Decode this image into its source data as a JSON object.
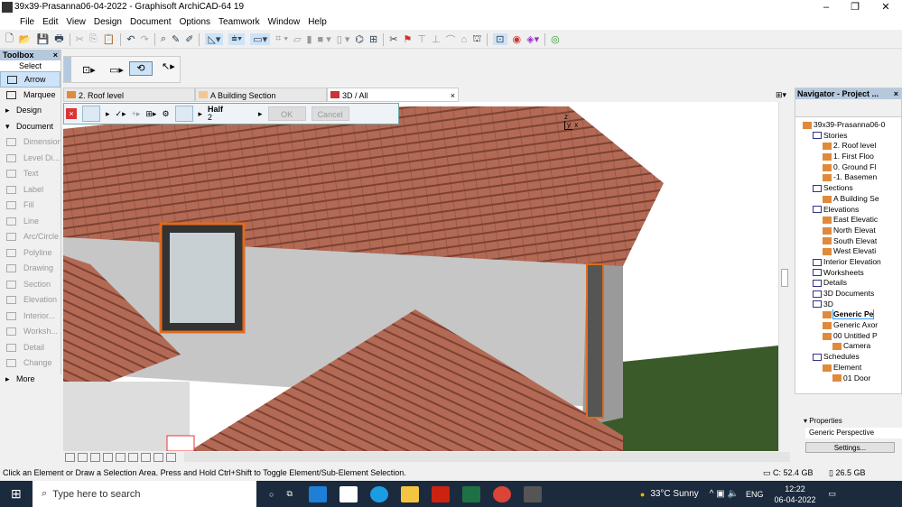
{
  "window": {
    "title": "39x39-Prasanna06-04-2022 - Graphisoft ArchiCAD-64 19",
    "minimize": "–",
    "maximize": "❐",
    "close": "✕"
  },
  "menu": [
    "File",
    "Edit",
    "View",
    "Design",
    "Document",
    "Options",
    "Teamwork",
    "Window",
    "Help"
  ],
  "toolbox": {
    "title": "Toolbox",
    "close": "×",
    "select": "Select",
    "items": [
      {
        "label": "Arrow",
        "state": "selected"
      },
      {
        "label": "Marquee",
        "state": "dark"
      },
      {
        "label": "Design",
        "state": "group"
      },
      {
        "label": "Document",
        "state": "group"
      },
      {
        "label": "Dimension"
      },
      {
        "label": "Level Di..."
      },
      {
        "label": "Text"
      },
      {
        "label": "Label"
      },
      {
        "label": "Fill"
      },
      {
        "label": "Line"
      },
      {
        "label": "Arc/Circle"
      },
      {
        "label": "Polyline"
      },
      {
        "label": "Drawing"
      },
      {
        "label": "Section"
      },
      {
        "label": "Elevation"
      },
      {
        "label": "Interior..."
      },
      {
        "label": "Worksh..."
      },
      {
        "label": "Detail"
      },
      {
        "label": "Change"
      },
      {
        "label": "More",
        "state": "group"
      }
    ]
  },
  "tabs": [
    {
      "label": "2. Roof level"
    },
    {
      "label": "A Building Section"
    },
    {
      "label": "3D / All",
      "active": true
    }
  ],
  "edit_palette": {
    "mode": "Half",
    "value": "2",
    "ok": "OK",
    "cancel": "Cancel"
  },
  "axis": {
    "z": "z",
    "y": "y",
    "x": "x"
  },
  "navigator": {
    "title": "Navigator - Project ...",
    "close": "×",
    "items": [
      {
        "label": "39x39-Prasanna06-0",
        "d": 0
      },
      {
        "label": "Stories",
        "d": 1,
        "b": true
      },
      {
        "label": "2. Roof level",
        "d": 2
      },
      {
        "label": "1. First Floo",
        "d": 2
      },
      {
        "label": "0. Ground Fl",
        "d": 2
      },
      {
        "label": "-1. Basemen",
        "d": 2
      },
      {
        "label": "Sections",
        "d": 1,
        "b": true
      },
      {
        "label": "A Building Se",
        "d": 2
      },
      {
        "label": "Elevations",
        "d": 1,
        "b": true
      },
      {
        "label": "East Elevatic",
        "d": 2
      },
      {
        "label": "North Elevat",
        "d": 2
      },
      {
        "label": "South Elevat",
        "d": 2
      },
      {
        "label": "West Elevati",
        "d": 2
      },
      {
        "label": "Interior Elevation",
        "d": 1,
        "b": true
      },
      {
        "label": "Worksheets",
        "d": 1,
        "b": true
      },
      {
        "label": "Details",
        "d": 1,
        "b": true
      },
      {
        "label": "3D Documents",
        "d": 1,
        "b": true
      },
      {
        "label": "3D",
        "d": 1,
        "b": true
      },
      {
        "label": "Generic Pe",
        "d": 2,
        "sel": true
      },
      {
        "label": "Generic Axor",
        "d": 2
      },
      {
        "label": "00 Untitled P",
        "d": 2
      },
      {
        "label": "Camera",
        "d": 3
      },
      {
        "label": "Schedules",
        "d": 1,
        "b": true
      },
      {
        "label": "Element",
        "d": 2
      },
      {
        "label": "01 Door",
        "d": 3
      }
    ]
  },
  "properties": {
    "title": "Properties",
    "value": "Generic Perspective",
    "settings": "Settings..."
  },
  "status": {
    "message": "Click an Element or Draw a Selection Area. Press and Hold Ctrl+Shift to Toggle Element/Sub-Element Selection.",
    "disk_c": "C: 52.4 GB",
    "memory": "26.5 GB"
  },
  "taskbar": {
    "search_placeholder": "Type here to search",
    "weather": "33°C  Sunny",
    "lang": "ENG",
    "time": "12:22",
    "date": "06-04-2022"
  }
}
